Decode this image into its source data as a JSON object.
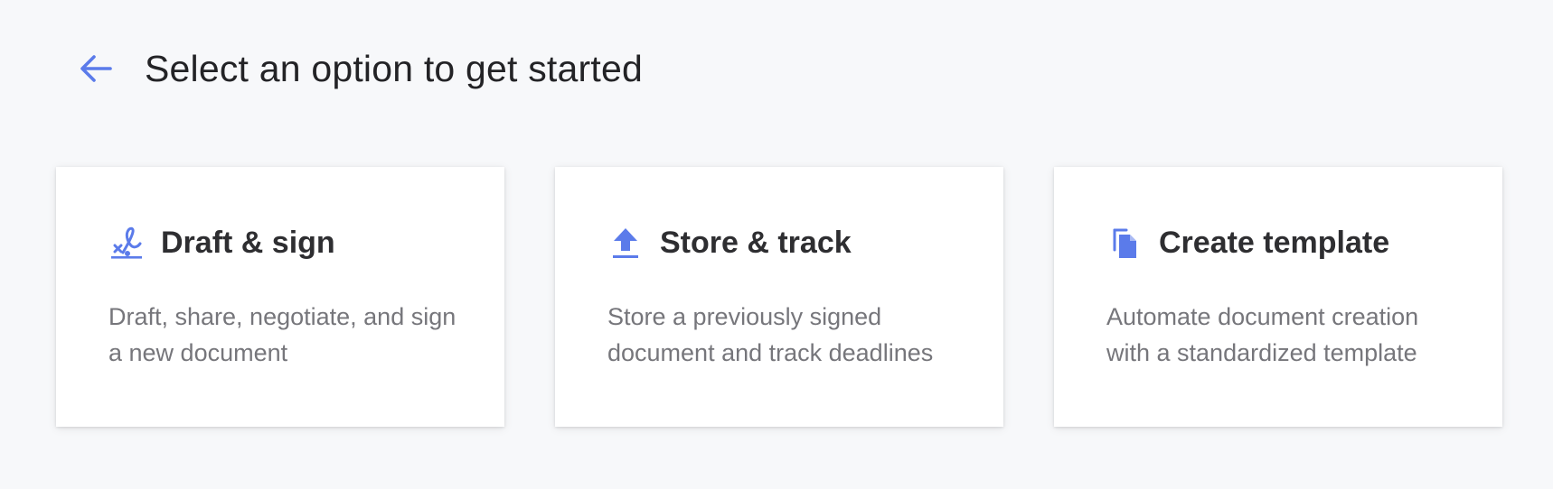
{
  "header": {
    "back_icon": "arrow-left-icon",
    "title": "Select an option to get started"
  },
  "accent_color": "#5b7bea",
  "cards": [
    {
      "icon": "signature-icon",
      "title": "Draft & sign",
      "description": "Draft, share, negotiate, and sign a new document"
    },
    {
      "icon": "upload-icon",
      "title": "Store & track",
      "description": "Store a previously signed document and track deadlines"
    },
    {
      "icon": "copy-document-icon",
      "title": "Create template",
      "description": "Automate document creation with a standardized template"
    }
  ]
}
